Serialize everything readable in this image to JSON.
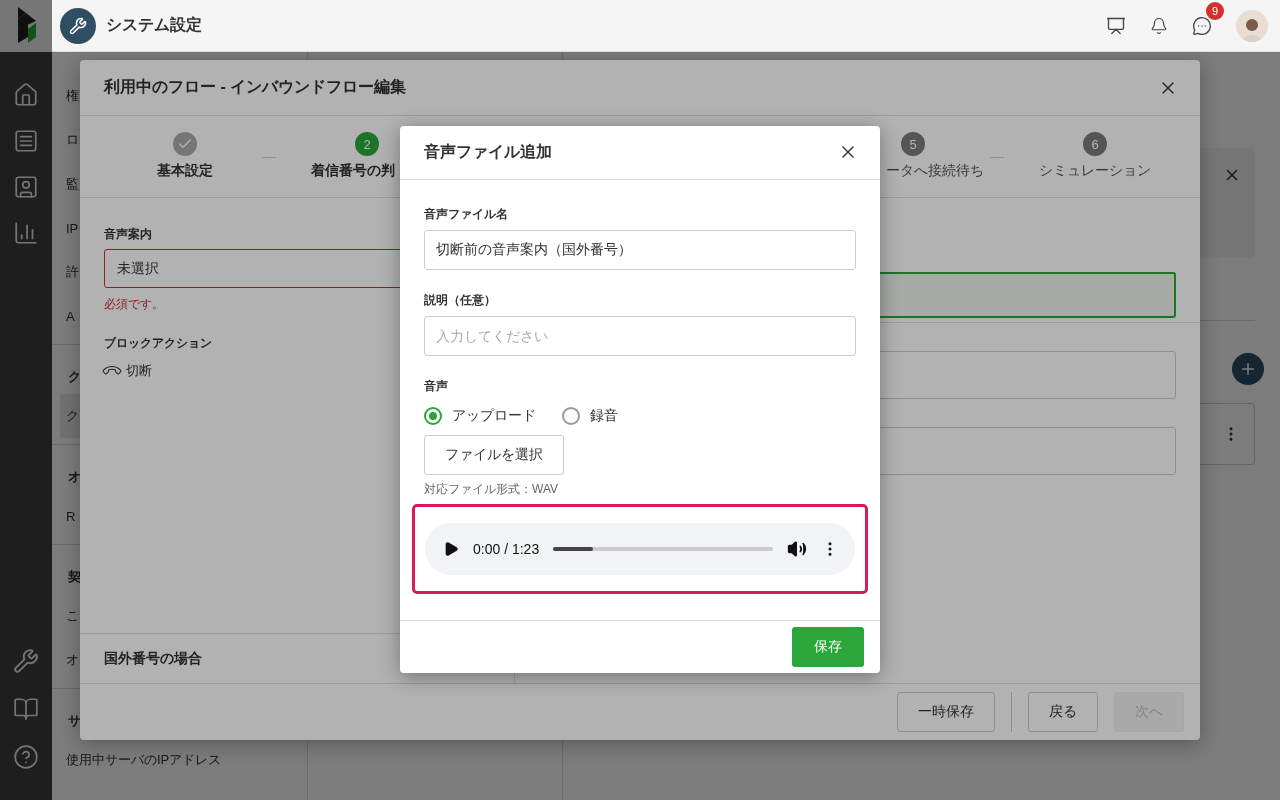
{
  "app_header": {
    "title": "システム設定",
    "notification_badge": "9"
  },
  "settings_nav": {
    "items": [
      {
        "label": "権",
        "kind": "item",
        "selected": false
      },
      {
        "label": "ロ",
        "kind": "item",
        "selected": false
      },
      {
        "label": "監",
        "kind": "item",
        "selected": false
      },
      {
        "label": "IP",
        "kind": "item",
        "selected": false
      },
      {
        "label": "許",
        "kind": "item",
        "selected": false
      },
      {
        "label": "A",
        "kind": "item",
        "selected": false
      },
      {
        "label": "ク",
        "kind": "section"
      },
      {
        "label": "ク",
        "kind": "item",
        "selected": true
      },
      {
        "label": "オ",
        "kind": "section"
      },
      {
        "label": "R",
        "kind": "item",
        "selected": false
      },
      {
        "label": "契",
        "kind": "section"
      },
      {
        "label": "こ",
        "kind": "item",
        "selected": false
      },
      {
        "label": "オ",
        "kind": "item",
        "selected": false
      },
      {
        "label": "サ",
        "kind": "section"
      },
      {
        "label": "使用中サーバのIPアドレス",
        "kind": "item",
        "selected": false
      }
    ]
  },
  "flow_modal": {
    "title": "利用中のフロー - インバウンドフロー編集",
    "steps": [
      {
        "label": "基本設定",
        "kind": "done"
      },
      {
        "number": "2",
        "label": "着信番号の判",
        "kind": "current"
      },
      {
        "number": "5",
        "label": "ータへ接続待ち",
        "kind": "pending"
      },
      {
        "number": "6",
        "label": "シミュレーション",
        "kind": "pending"
      }
    ],
    "voice_guide": {
      "label": "音声案内",
      "value": "未選択",
      "error": "必須です。"
    },
    "block_action": {
      "label": "ブロックアクション",
      "action": "切断"
    },
    "branch": {
      "title": "国外番号の場合"
    },
    "buttons": [
      {
        "label": "一時保存",
        "disabled": false
      },
      {
        "label": "戻る",
        "disabled": false
      },
      {
        "label": "次へ",
        "disabled": true
      }
    ]
  },
  "audio_dialog": {
    "title": "音声ファイル追加",
    "file_name": {
      "label": "音声ファイル名",
      "value": "切断前の音声案内（国外番号）"
    },
    "description": {
      "label": "説明（任意）",
      "placeholder": "入力してください"
    },
    "voice": {
      "label": "音声",
      "options": [
        {
          "label": "アップロード",
          "selected": true
        },
        {
          "label": "録音",
          "selected": false
        }
      ]
    },
    "file_button": "ファイルを選択",
    "format_note": "対応ファイル形式：WAV",
    "player": {
      "time": "0:00 / 1:23",
      "level": 0.18,
      "highlighted": true
    },
    "save_button": "保存"
  }
}
